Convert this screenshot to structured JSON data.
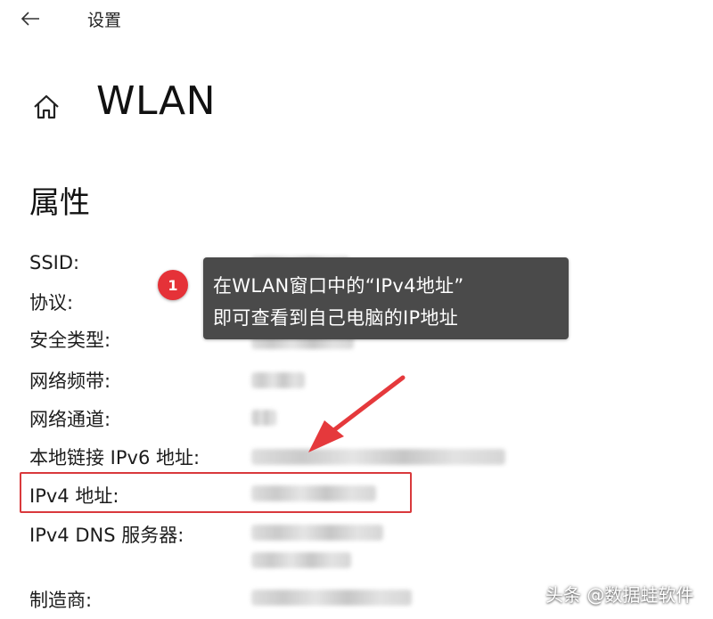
{
  "app": {
    "title": "设置"
  },
  "header": {
    "page_title": "WLAN"
  },
  "section": {
    "title": "属性"
  },
  "properties": [
    {
      "label": "SSID:"
    },
    {
      "label": "协议:"
    },
    {
      "label": "安全类型:"
    },
    {
      "label": "网络频带:"
    },
    {
      "label": "网络通道:"
    },
    {
      "label": "本地链接 IPv6 地址:"
    },
    {
      "label": "IPv4 地址:"
    },
    {
      "label": "IPv4 DNS 服务器:"
    },
    {
      "label": "制造商:"
    }
  ],
  "annotation": {
    "step": "1",
    "line1": "在WLAN窗口中的“IPv4地址”",
    "line2": "即可查看到自己电脑的IP地址",
    "highlight_color": "#d9393c",
    "badge_color": "#e53238"
  },
  "watermark": {
    "text": "头条 @数据蛙软件"
  },
  "icons": {
    "back": "back-arrow-icon",
    "home": "home-icon"
  }
}
